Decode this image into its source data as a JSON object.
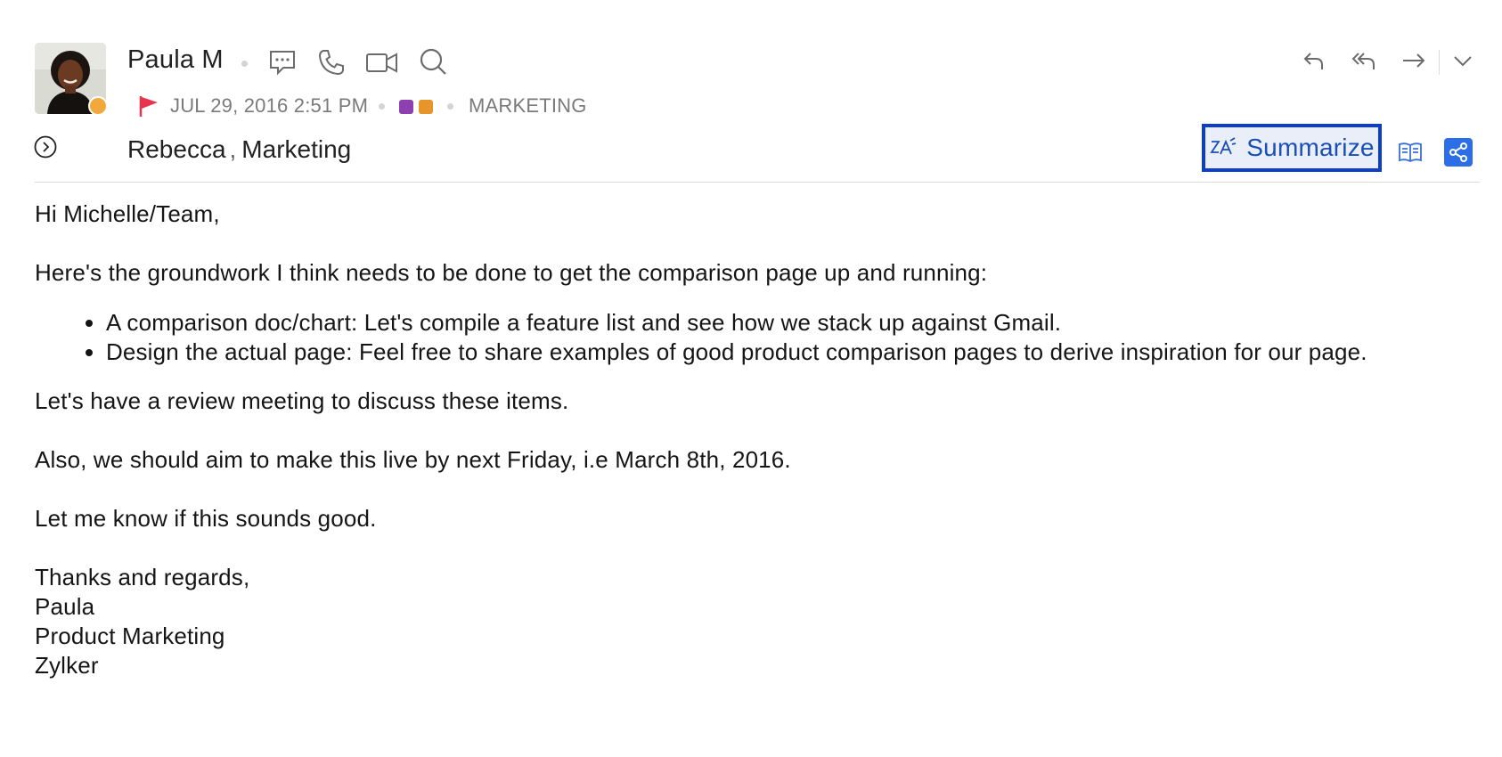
{
  "sender": {
    "name": "Paula M",
    "presence_color": "#f2a93b"
  },
  "meta": {
    "date": "JUL 29, 2016 2:51 PM",
    "flag_color": "#e8344e",
    "tag_colors": [
      "#8e3fb0",
      "#e5952a"
    ],
    "folder": "MARKETING"
  },
  "recipients": {
    "first": "Rebecca",
    "separator": ",",
    "second": "Marketing"
  },
  "actions": {
    "summarize_label": "Summarize",
    "accent": "#0d3ec8",
    "icons": [
      "chat-icon",
      "phone-icon",
      "video-icon",
      "search-icon",
      "reply-icon",
      "reply-all-icon",
      "forward-icon",
      "chevron-down-icon",
      "expand-details-icon",
      "summarize-icon",
      "reading-mode-icon",
      "share-icon"
    ]
  },
  "email": {
    "greeting": "Hi Michelle/Team,",
    "intro": "Here's the groundwork I think needs to be done to get the comparison page up and running:",
    "bullets": [
      "A comparison doc/chart: Let's compile a feature list and see how we stack up against Gmail.",
      "Design the actual page: Feel free to share examples of good product comparison pages to derive inspiration for our page."
    ],
    "para1": "Let's have a review meeting to discuss these items.",
    "para2": "Also, we should aim to make this live by next Friday, i.e March 8th, 2016.",
    "para3": "Let me know if this sounds good.",
    "signoff": "Thanks and regards,",
    "sig_name": "Paula",
    "sig_title": "Product Marketing",
    "sig_company": "Zylker"
  }
}
